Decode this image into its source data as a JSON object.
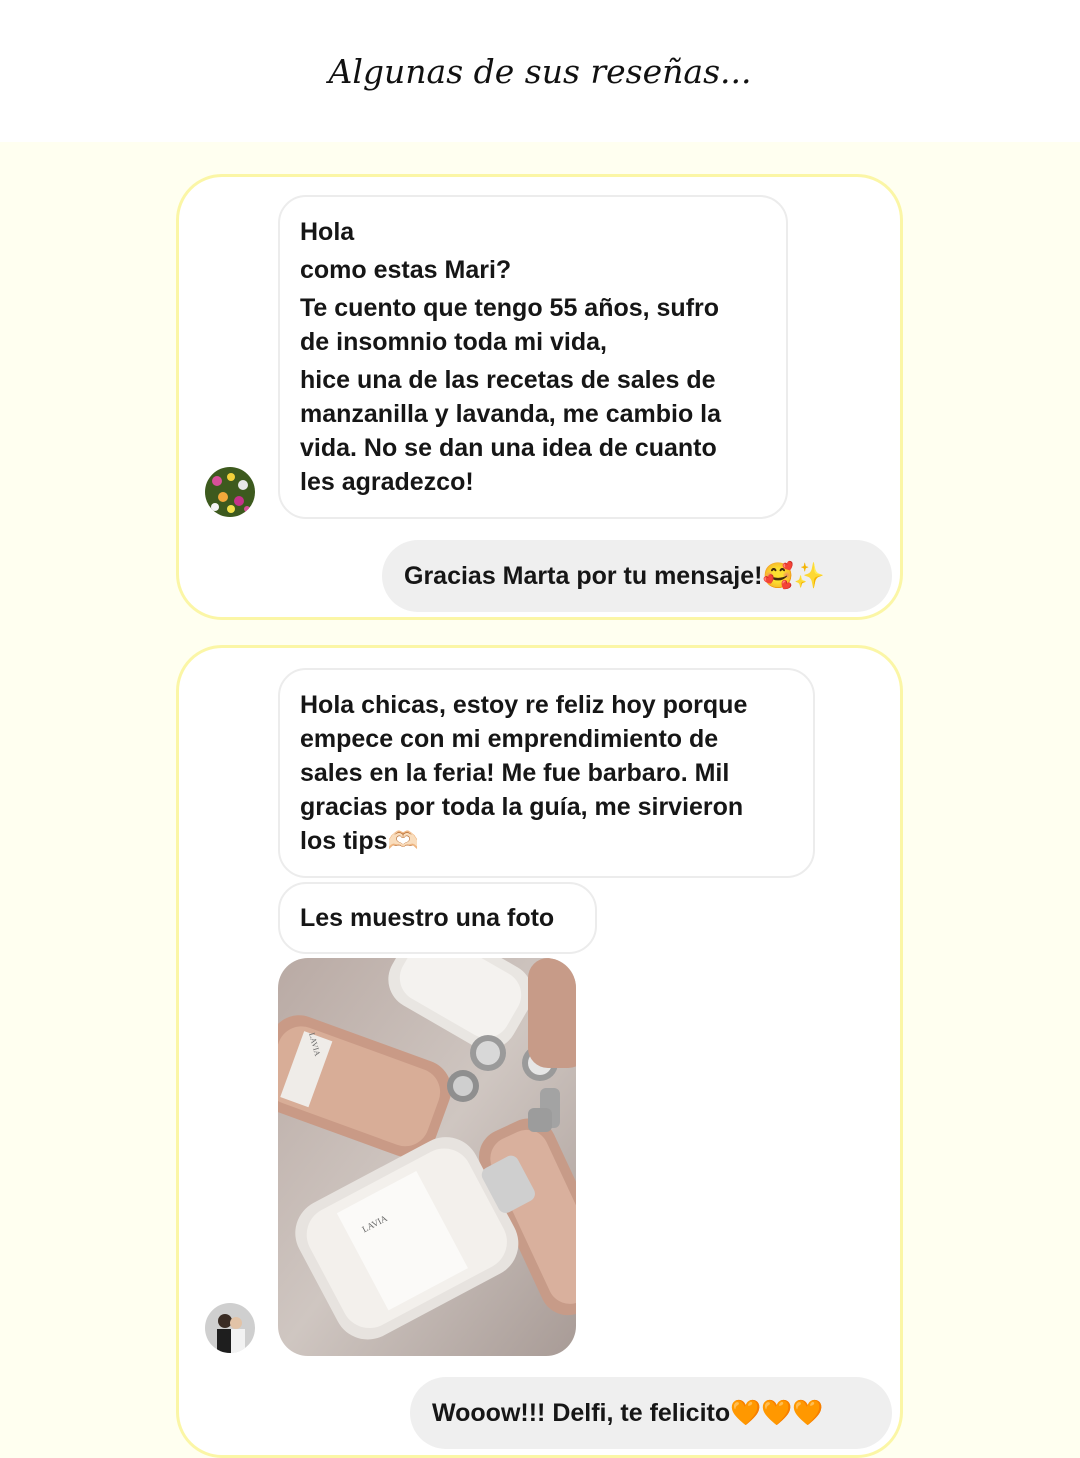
{
  "heading": "Algunas de sus reseñas...",
  "reviews": [
    {
      "incoming": [
        {
          "lines": [
            "Hola",
            "como estas Mari?",
            "Te cuento que tengo 55 años, sufro",
            "de insomnio toda mi vida,",
            "hice una de las recetas de sales de",
            "manzanilla y lavanda, me cambio la",
            "vida. No se dan una idea de cuanto",
            "les agradezco!"
          ]
        }
      ],
      "reply": "Gracias Marta por tu mensaje!🥰✨",
      "avatar": "flowers-avatar"
    },
    {
      "incoming": [
        {
          "lines": [
            "Hola chicas, estoy re feliz hoy porque",
            "empece con mi emprendimiento de",
            "sales en la feria! Me fue barbaro. Mil",
            "gracias por toda la guía, me sirvieron",
            "los tips🫶🏻"
          ]
        },
        {
          "lines": [
            "Les muestro una foto"
          ]
        }
      ],
      "photo_labels": [
        "LAVIA",
        "LAVIA"
      ],
      "reply": "Wooow!!! Delfi, te felicito🧡🧡🧡",
      "avatar": "person-avatar"
    }
  ],
  "colors": {
    "page_bg": "#fffff0",
    "card_border": "#fbf6a6",
    "reply_bg": "#efefef"
  }
}
